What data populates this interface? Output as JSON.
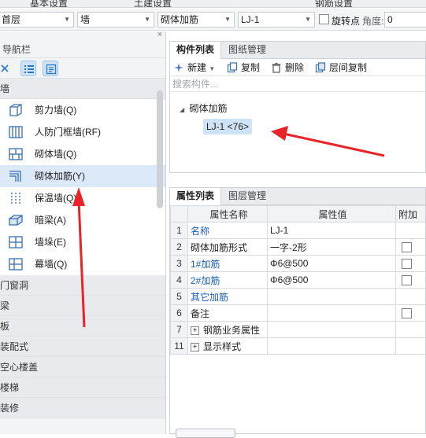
{
  "ribbon": {
    "tabs": [
      "基本设置",
      "土建设置",
      "钢筋设置"
    ]
  },
  "toolbar": {
    "floor": "首层",
    "category": "墙",
    "type": "砌体加筋",
    "component": "LJ-1",
    "rotate_label": "旋转点",
    "angle_label": "角度:",
    "angle_value": "0"
  },
  "nav": {
    "title": "导航栏",
    "close": "×",
    "groups": [
      "墙",
      "门窗洞",
      "梁",
      "板",
      "装配式",
      "空心楼盖",
      "楼梯",
      "装修"
    ],
    "wall_items": [
      {
        "label": "剪力墙(Q)",
        "icon": "shear-wall-icon"
      },
      {
        "label": "人防门框墙(RF)",
        "icon": "civil-defense-door-wall-icon"
      },
      {
        "label": "砌体墙(Q)",
        "icon": "masonry-wall-icon"
      },
      {
        "label": "砌体加筋(Y)",
        "icon": "masonry-rebar-icon",
        "selected": true
      },
      {
        "label": "保温墙(Q)",
        "icon": "insulation-wall-icon"
      },
      {
        "label": "暗梁(A)",
        "icon": "hidden-beam-icon"
      },
      {
        "label": "墙垛(E)",
        "icon": "wall-pier-icon"
      },
      {
        "label": "幕墙(Q)",
        "icon": "curtain-wall-icon"
      }
    ]
  },
  "components_panel": {
    "tabs": [
      "构件列表",
      "图纸管理"
    ],
    "actions": [
      "新建",
      "复制",
      "删除",
      "层间复制"
    ],
    "search_placeholder": "搜索构件...",
    "tree_root": "砌体加筋",
    "tree_item": "LJ-1 <76>"
  },
  "properties_panel": {
    "tabs": [
      "属性列表",
      "图层管理"
    ],
    "columns": [
      "属性名称",
      "属性值",
      "附加"
    ],
    "rows": [
      {
        "idx": "1",
        "name": "名称",
        "value": "LJ-1",
        "blue": true,
        "checkbox": false,
        "expand": false
      },
      {
        "idx": "2",
        "name": "砌体加筋形式",
        "value": "一字-2形",
        "blue": false,
        "checkbox": true,
        "expand": false
      },
      {
        "idx": "3",
        "name": "1#加筋",
        "value": "Φ6@500",
        "blue": true,
        "checkbox": true,
        "expand": false
      },
      {
        "idx": "4",
        "name": "2#加筋",
        "value": "Φ6@500",
        "blue": true,
        "checkbox": true,
        "expand": false
      },
      {
        "idx": "5",
        "name": "其它加筋",
        "value": "",
        "blue": true,
        "checkbox": false,
        "expand": false
      },
      {
        "idx": "6",
        "name": "备注",
        "value": "",
        "blue": false,
        "checkbox": true,
        "expand": false
      },
      {
        "idx": "7",
        "name": "钢筋业务属性",
        "value": "",
        "blue": false,
        "checkbox": false,
        "expand": true
      },
      {
        "idx": "11",
        "name": "显示样式",
        "value": "",
        "blue": false,
        "checkbox": false,
        "expand": true
      }
    ]
  },
  "colors": {
    "accent": "#1a5fb4",
    "selection": "#dbe9f9",
    "annotation_arrow": "#e8242b"
  }
}
